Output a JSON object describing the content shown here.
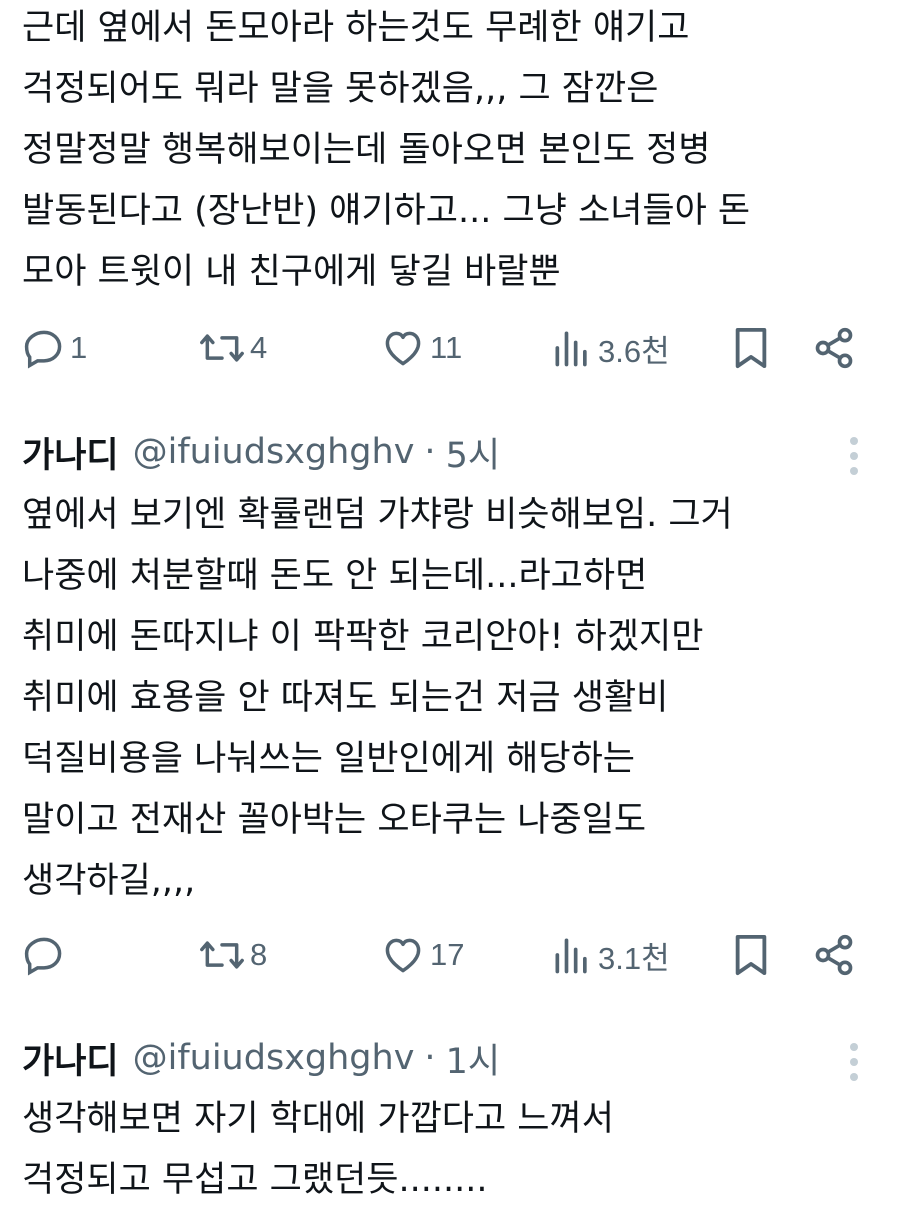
{
  "tweets": [
    {
      "text": "근데 옆에서 돈모아라 하는것도 무례한 얘기고\n걱정되어도 뭐라 말을 못하겠음,,, 그 잠깐은\n정말정말 행복해보이는데 돌아오면 본인도 정병\n발동된다고 (장난반) 얘기하고... 그냥 소녀들아 돈\n모아 트윗이 내 친구에게 닿길 바랄뿐",
      "replies": "1",
      "retweets": "4",
      "likes": "11",
      "views": "3.6천"
    },
    {
      "display_name": "가나디",
      "handle": "@ifuiudsxghghv",
      "separator": "·",
      "time": "5시",
      "text": "옆에서 보기엔 확률랜덤 가챠랑 비슷해보임. 그거\n나중에 처분할때 돈도 안 되는데...라고하면\n취미에 돈따지냐 이 팍팍한 코리안아! 하겠지만\n취미에 효용을 안 따져도 되는건 저금 생활비\n덕질비용을 나눠쓰는 일반인에게 해당하는\n말이고 전재산 꼴아박는 오타쿠는 나중일도\n생각하길,,,,",
      "replies": "",
      "retweets": "8",
      "likes": "17",
      "views": "3.1천"
    },
    {
      "display_name": "가나디",
      "handle": "@ifuiudsxghghv",
      "separator": "·",
      "time": "1시",
      "text": "생각해보면 자기 학대에 가깝다고 느껴서\n걱정되고 무섭고 그랬던듯........"
    }
  ],
  "icons": {
    "reply": "reply-icon",
    "retweet": "retweet-icon",
    "like": "heart-icon",
    "views": "views-icon",
    "bookmark": "bookmark-icon",
    "share": "share-icon",
    "more": "more-icon"
  },
  "colors": {
    "text": "#0f1419",
    "secondary": "#536471",
    "background": "#ffffff"
  }
}
